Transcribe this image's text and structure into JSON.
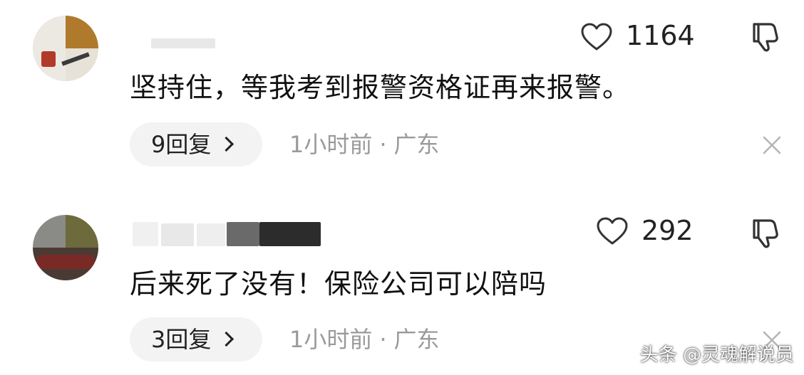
{
  "comments": [
    {
      "like_count": "1164",
      "text": "坚持住，等我考到报警资格证再来报警。",
      "replies_label": "9回复",
      "time": "1小时前",
      "separator": "·",
      "location": "广东"
    },
    {
      "like_count": "292",
      "text": "后来死了没有！保险公司可以陪吗",
      "replies_label": "3回复",
      "time": "1小时前",
      "separator": "·",
      "location": "广东"
    }
  ],
  "watermark": "头条 @灵魂解说员",
  "colors": {
    "background": "#ffffff",
    "text": "#111111",
    "meta": "#9a9a9a",
    "pill": "#f3f3f3"
  },
  "icons": [
    "heart-outline-icon",
    "thumbs-down-icon",
    "chevron-right-icon",
    "close-icon"
  ]
}
